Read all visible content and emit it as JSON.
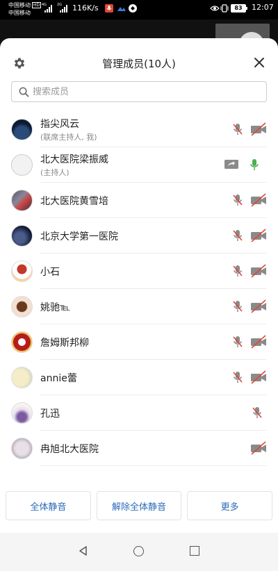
{
  "status_bar": {
    "carrier1": "中国移动",
    "carrier2": "中国移动",
    "hd": "HD",
    "net1": "4G",
    "net2": "2G",
    "speed": "116K/s",
    "battery": "83",
    "time": "12:07"
  },
  "sheet": {
    "title": "管理成员(10人)",
    "search_placeholder": "搜索成员"
  },
  "members": [
    {
      "name": "指尖风云",
      "role": "(联席主持人, 我)",
      "mic": "muted",
      "cam": "off"
    },
    {
      "name": "北大医院梁振威",
      "role": "(主持人)",
      "mic": "on",
      "cam": "share"
    },
    {
      "name": "北大医院黄雪培",
      "role": "",
      "mic": "muted",
      "cam": "off"
    },
    {
      "name": "北京大学第一医院",
      "role": "",
      "mic": "muted",
      "cam": "off"
    },
    {
      "name": "小石",
      "role": "",
      "mic": "muted",
      "cam": "off"
    },
    {
      "name": "姚驰℡ ",
      "role": "",
      "mic": "muted",
      "cam": "off"
    },
    {
      "name": "詹姆斯邦柳",
      "role": "",
      "mic": "muted",
      "cam": "off"
    },
    {
      "name": "annie蕾",
      "role": "",
      "mic": "muted",
      "cam": "off"
    },
    {
      "name": "孔迅",
      "role": "",
      "mic": "muted",
      "cam": "none"
    },
    {
      "name": "冉旭北大医院",
      "role": "",
      "mic": "none",
      "cam": "off"
    }
  ],
  "buttons": {
    "mute_all": "全体静音",
    "unmute_all": "解除全体静音",
    "more": "更多"
  },
  "colors": {
    "accent": "#2b6bb8",
    "mute_red": "#e0473a",
    "mic_green": "#4caf50",
    "icon_gray": "#888888"
  }
}
